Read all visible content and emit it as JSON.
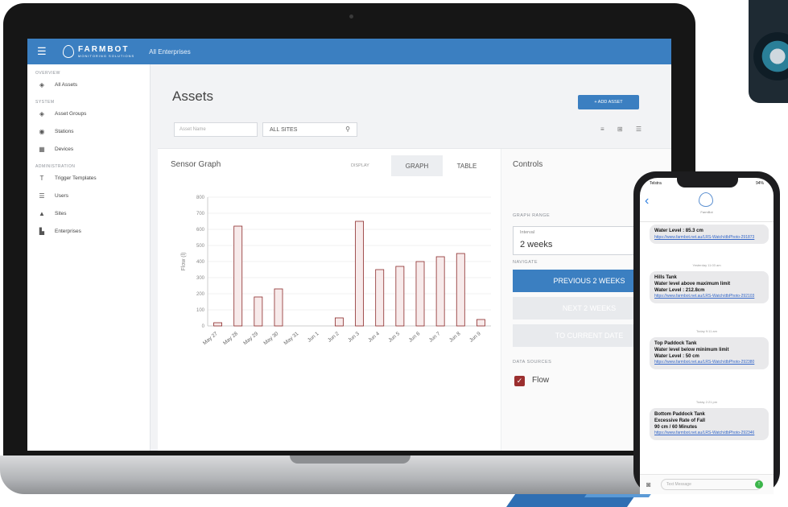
{
  "app": {
    "brand": "FARMBOT",
    "brand_sub": "MONITORING SOLUTIONS",
    "org_label": "All Enterprises"
  },
  "sidebar": {
    "sections": [
      {
        "label": "OVERVIEW",
        "items": [
          {
            "label": "All Assets",
            "icon": "location-icon"
          }
        ]
      },
      {
        "label": "SYSTEM",
        "items": [
          {
            "label": "Asset Groups",
            "icon": "location-icon"
          },
          {
            "label": "Stations",
            "icon": "station-icon"
          },
          {
            "label": "Devices",
            "icon": "device-icon"
          }
        ]
      },
      {
        "label": "ADMINISTRATION",
        "items": [
          {
            "label": "Trigger Templates",
            "icon": "trigger-icon"
          },
          {
            "label": "Users",
            "icon": "users-icon"
          },
          {
            "label": "Sites",
            "icon": "sites-icon"
          },
          {
            "label": "Enterprises",
            "icon": "enterprise-icon"
          }
        ]
      }
    ]
  },
  "main": {
    "title": "Assets",
    "add_button": "+ ADD ASSET",
    "filter_name_placeholder": "Asset Name",
    "filter_site": "ALL SITES",
    "view_icons": "≡ ⊞ ☰"
  },
  "graph": {
    "title": "Sensor Graph",
    "display_label": "DISPLAY",
    "tab_graph": "GRAPH",
    "tab_table": "TABLE"
  },
  "controls": {
    "title": "Controls",
    "graph_range_label": "GRAPH RANGE",
    "interval_label": "Interval",
    "interval_value": "2 weeks",
    "navigate_label": "NAVIGATE",
    "prev_button": "PREVIOUS 2 WEEKS",
    "next_button": "NEXT 2 WEEKS",
    "current_button": "TO CURRENT DATE",
    "data_sources_label": "DATA SOURCES",
    "source_name": "Flow"
  },
  "chart_data": {
    "type": "bar",
    "ylabel": "Flow (l)",
    "ylim": [
      0,
      800
    ],
    "yticks": [
      "800",
      "700",
      "600",
      "500",
      "400",
      "300",
      "200",
      "100",
      "0"
    ],
    "categories": [
      "May 27",
      "May 28",
      "May 29",
      "May 30",
      "May 31",
      "Jun 1",
      "Jun 2",
      "Jun 3",
      "Jun 4",
      "Jun 5",
      "Jun 6",
      "Jun 7",
      "Jun 8",
      "Jun 9"
    ],
    "values": [
      20,
      620,
      180,
      230,
      0,
      0,
      50,
      650,
      350,
      370,
      400,
      430,
      450,
      40
    ],
    "bar_color": "#8c2a2a"
  },
  "phone": {
    "carrier": "Telstra",
    "battery": "94%",
    "contact": "FarmBot",
    "messages": [
      {
        "title": "",
        "lines": [
          "Water Level : 85.3 cm"
        ],
        "link": "https://www.farmbot.net.au/LRS-Watch/dbPhoto-291873",
        "time": ""
      },
      {
        "title": "Hills Tank",
        "lines": [
          "Water level above maximum limit",
          "Water Level : 212.8cm"
        ],
        "link": "https://www.farmbot.net.au/LRS-Watch/dbPhoto-292103",
        "time": "Yesterday 11:03 am"
      },
      {
        "title": "Top Paddock Tank",
        "lines": [
          "Water level below minimum limit",
          "Water Level : 50 cm"
        ],
        "link": "https://www.farmbot.net.au/LRS-Watch/dbPhoto-292380",
        "time": "Today 9:11 am"
      },
      {
        "title": "Bottom Paddock Tank",
        "lines": [
          "Excessive Rate of Fall",
          "90 cm / 60 Minutes"
        ],
        "link": "https://www.farmbot.net.au/LRS-Watch/dbPhoto-292346",
        "time": "Today 2:21 pm"
      }
    ],
    "input_placeholder": "Text Message"
  }
}
